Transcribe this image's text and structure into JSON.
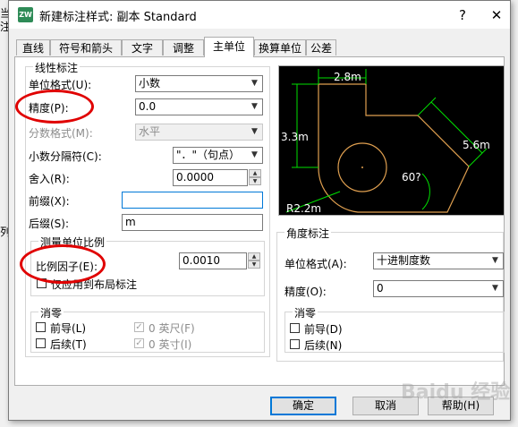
{
  "background": {
    "left_chars": [
      "当",
      "注",
      "列"
    ]
  },
  "dialog": {
    "title": "新建标注样式: 副本 Standard",
    "help_glyph": "?",
    "close_glyph": "✕",
    "icon_text": "ZWCAD"
  },
  "tabs": [
    {
      "label": "直线",
      "active": false
    },
    {
      "label": "符号和箭头",
      "active": false
    },
    {
      "label": "文字",
      "active": false
    },
    {
      "label": "调整",
      "active": false
    },
    {
      "label": "主单位",
      "active": true
    },
    {
      "label": "换算单位",
      "active": false
    },
    {
      "label": "公差",
      "active": false
    }
  ],
  "linear": {
    "title": "线性标注",
    "unit_format": {
      "label": "单位格式(U):",
      "value": "小数"
    },
    "precision": {
      "label": "精度(P):",
      "value": "0.0"
    },
    "fraction_format": {
      "label": "分数格式(M):",
      "value": "水平"
    },
    "decimal_separator": {
      "label": "小数分隔符(C):",
      "value": "\"．\"（句点）"
    },
    "round_off": {
      "label": "舍入(R):",
      "value": "0.0000"
    },
    "prefix": {
      "label": "前缀(X):",
      "value": ""
    },
    "suffix": {
      "label": "后缀(S):",
      "value": "m"
    },
    "scale": {
      "title": "测量单位比例",
      "factor": {
        "label": "比例因子(E):",
        "value": "0.0010"
      },
      "layout_only": {
        "label": "仅应用到布局标注",
        "checked": false
      }
    },
    "zero": {
      "title": "消零",
      "leading": {
        "label": "前导(L)",
        "checked": false
      },
      "trailing": {
        "label": "后续(T)",
        "checked": false
      },
      "feet": {
        "label": "0 英尺(F)",
        "checked": true
      },
      "inches": {
        "label": "0 英寸(I)",
        "checked": true
      }
    }
  },
  "angular": {
    "title": "角度标注",
    "unit_format": {
      "label": "单位格式(A):",
      "value": "十进制度数"
    },
    "precision": {
      "label": "精度(O):",
      "value": "0"
    },
    "zero": {
      "title": "消零",
      "leading": {
        "label": "前导(D)",
        "checked": false
      },
      "trailing": {
        "label": "后续(N)",
        "checked": false
      }
    }
  },
  "preview": {
    "labels": [
      "2.8m",
      "3.3m",
      "5.6m",
      "60?",
      "R2.2m"
    ],
    "colors": {
      "background": "#000000",
      "dimension": "#00ff00",
      "geometry": "#e0a050",
      "text": "#ffffff"
    }
  },
  "buttons": {
    "ok": "确定",
    "cancel": "取消",
    "help": "帮助(H)"
  },
  "annotations": {
    "highlight_color": "#e00000"
  },
  "watermark": "Baidu 经验"
}
